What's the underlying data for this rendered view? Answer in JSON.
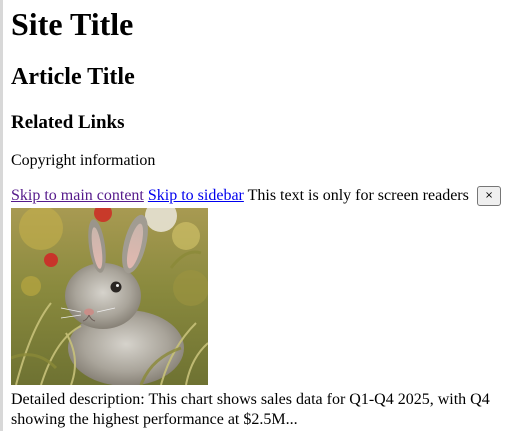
{
  "site": {
    "title": "Site Title"
  },
  "article": {
    "title": "Article Title"
  },
  "sidebar": {
    "heading": "Related Links"
  },
  "footer": {
    "copyright": "Copyright information"
  },
  "skip_links": {
    "main": "Skip to main content",
    "sidebar": "Skip to sidebar"
  },
  "screen_reader_text": "This text is only for screen readers",
  "close_button_label": "×",
  "image": {
    "subject": "rabbit"
  },
  "description": "Detailed description: This chart shows sales data for Q1-Q4 2025, with Q4 showing the highest performance at $2.5M...",
  "colors": {
    "visited_link": "#551a8b",
    "link": "#0000ee",
    "left_border": "#d8d8d8"
  }
}
